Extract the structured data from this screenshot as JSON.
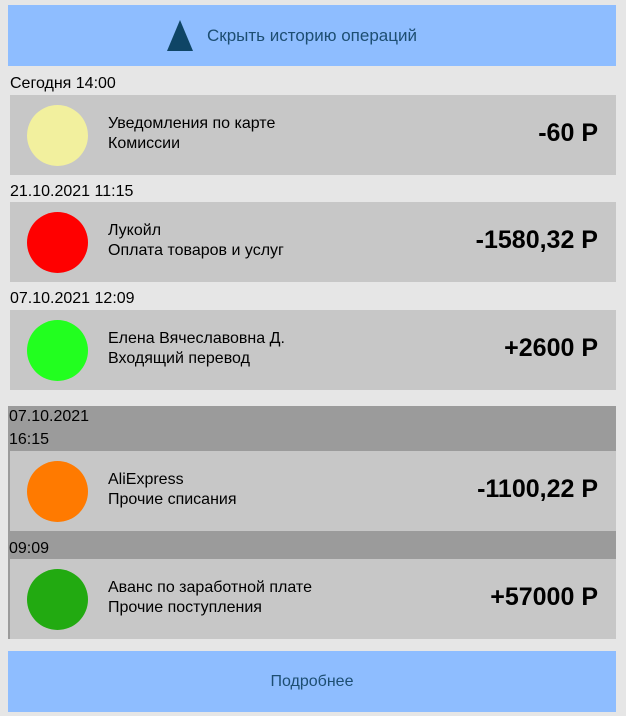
{
  "toggle": {
    "label": "Скрыть  историю операций"
  },
  "groups": [
    {
      "date": "Сегодня 14:00",
      "operation": {
        "title": "Уведомления по карте",
        "subtitle": "Комиссии",
        "amount": "-60 Р",
        "color": "#f2f09e"
      }
    },
    {
      "date": "21.10.2021 11:15",
      "operation": {
        "title": "Лукойл",
        "subtitle": "Оплата товаров и услуг",
        "amount": "-1580,32 Р",
        "color": "#ff0000"
      }
    },
    {
      "date": "07.10.2021 12:09",
      "operation": {
        "title": "Елена Вячеславовна Д.",
        "subtitle": "Входящий перевод",
        "amount": "+2600 Р",
        "color": "#22ff1f"
      }
    }
  ],
  "expanded_group": {
    "date": "07.10.2021",
    "items": [
      {
        "time": "16:15",
        "title": "AliExpress",
        "subtitle": "Прочие списания",
        "amount": "-1100,22 Р",
        "color": "#ff7a00"
      },
      {
        "time": "09:09",
        "title": "Аванс по заработной плате",
        "subtitle": "Прочие поступления",
        "amount": "+57000 Р",
        "color": "#22aa11"
      }
    ]
  },
  "more": {
    "label": "Подробнее"
  },
  "colors": {
    "button_bg": "#8ebdff",
    "button_text": "#1d4e72",
    "card_bg": "#c7c7c7",
    "group_bg": "#9b9b9b"
  }
}
